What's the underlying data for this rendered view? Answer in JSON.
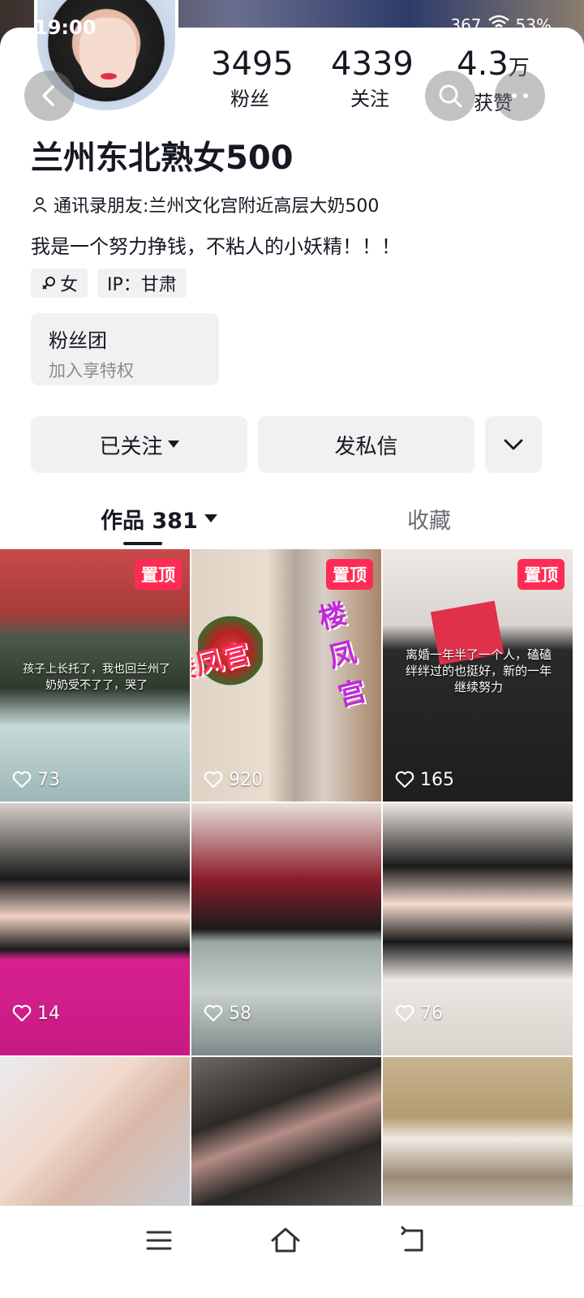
{
  "status": {
    "time": "19:00",
    "signal": "367",
    "battery": "53%"
  },
  "profile": {
    "name": "兰州东北熟女500",
    "contact": "通讯录朋友:兰州文化宫附近高层大奶500",
    "bio": "我是一个努力挣钱，不粘人的小妖精！！！",
    "tags": {
      "gender": "女",
      "ip": "IP：甘肃"
    }
  },
  "stats": {
    "fans": {
      "value": "3495",
      "label": "粉丝"
    },
    "following": {
      "value": "4339",
      "label": "关注"
    },
    "likes": {
      "value": "4.3",
      "unit": "万",
      "label": "获赞"
    }
  },
  "fanclub": {
    "title": "粉丝团",
    "subtitle": "加入享特权"
  },
  "actions": {
    "followed": "已关注",
    "message": "发私信"
  },
  "tabs": {
    "works": "作品 381",
    "favorites": "收藏"
  },
  "icons": [
    "back-icon",
    "search-icon",
    "more-icon",
    "person-icon",
    "female-icon",
    "caret-down-icon",
    "chevron-down-icon",
    "heart-icon",
    "menu-icon",
    "home-icon",
    "back-nav-icon"
  ],
  "colors": {
    "accent": "#fe2c55",
    "chip_bg": "#f1f1f2",
    "text": "#161823"
  },
  "grid": {
    "pin_label": "置顶",
    "items": [
      {
        "likes": "73",
        "pinned": true,
        "caption": "孩子上长托了，我也回兰州了\n奶奶受不了了，哭了"
      },
      {
        "likes": "920",
        "pinned": true,
        "watermark": "楼凤宫"
      },
      {
        "likes": "165",
        "pinned": true,
        "caption": "离婚一年半了一个人，磕磕\n绊绊过的也挺好，新的一年\n继续努力"
      },
      {
        "likes": "14",
        "pinned": false
      },
      {
        "likes": "58",
        "pinned": false
      },
      {
        "likes": "76",
        "pinned": false
      },
      {
        "likes": "",
        "pinned": false
      },
      {
        "likes": "",
        "pinned": false
      },
      {
        "likes": "",
        "pinned": false
      }
    ]
  }
}
